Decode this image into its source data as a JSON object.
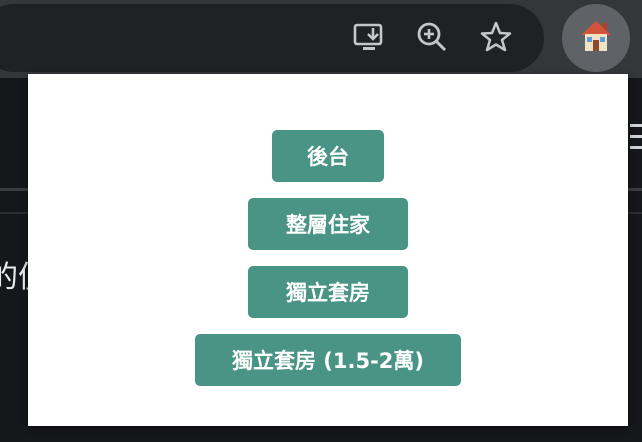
{
  "toolbar": {
    "icons": [
      "install-app-icon",
      "zoom-icon",
      "bookmark-star-icon"
    ],
    "extension_icon": "house-icon"
  },
  "page": {
    "partial_text": "的便"
  },
  "popup": {
    "buttons": [
      {
        "label": "後台"
      },
      {
        "label": "整層住家"
      },
      {
        "label": "獨立套房"
      },
      {
        "label": "獨立套房 (1.5-2萬)"
      }
    ],
    "button_color": "#4a9486"
  }
}
